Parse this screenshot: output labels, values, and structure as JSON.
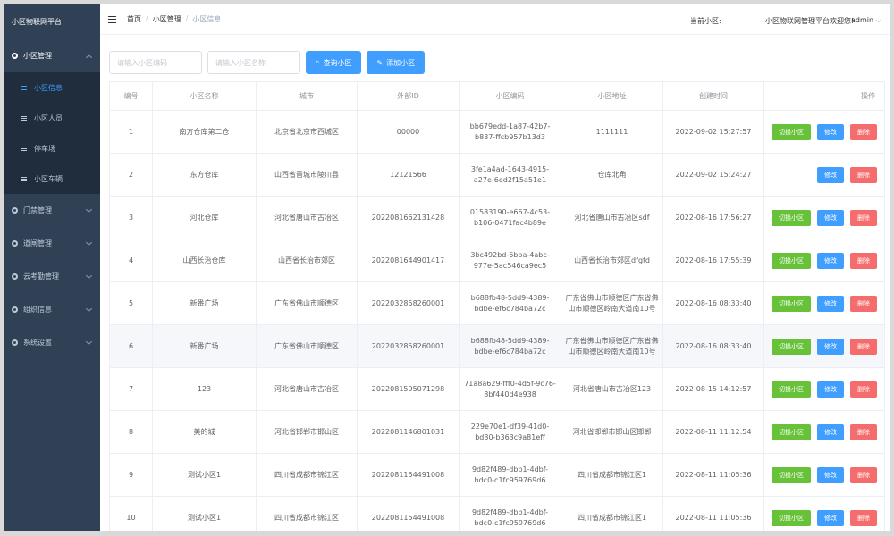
{
  "app": {
    "title": "小区物联网平台"
  },
  "sidebar": {
    "menus": [
      {
        "label": "小区管理",
        "open": true,
        "items": [
          {
            "label": "小区信息",
            "active": true
          },
          {
            "label": "小区人员",
            "active": false
          },
          {
            "label": "停车场",
            "active": false
          },
          {
            "label": "小区车辆",
            "active": false
          }
        ]
      },
      {
        "label": "门禁管理",
        "open": false,
        "items": []
      },
      {
        "label": "道闸管理",
        "open": false,
        "items": []
      },
      {
        "label": "云考勤管理",
        "open": false,
        "items": []
      },
      {
        "label": "组织信息",
        "open": false,
        "items": []
      },
      {
        "label": "系统设置",
        "open": false,
        "items": []
      }
    ]
  },
  "header": {
    "breadcrumb": [
      "首页",
      "小区管理",
      "小区信息"
    ],
    "current_label": "当前小区:",
    "welcome": "小区物联网管理平台欢迎您!",
    "user": "admin"
  },
  "toolbar": {
    "code_placeholder": "请输入小区编码",
    "name_placeholder": "请输入小区名称",
    "query_label": "查询小区",
    "add_label": "添加小区"
  },
  "table": {
    "columns": [
      "编号",
      "小区名称",
      "城市",
      "外部ID",
      "小区编码",
      "小区地址",
      "创建时间",
      "操作"
    ],
    "op_labels": {
      "switch": "切换小区",
      "edit": "修改",
      "delete": "删除"
    },
    "rows": [
      {
        "no": "1",
        "name": "南方仓库第二仓",
        "city": "北京省北京市西城区",
        "ext": "00000",
        "code": "bb679edd-1a87-42b7-b837-ffcb957b13d3",
        "addr": "1111111",
        "time": "2022-09-02 15:27:57",
        "switch": true
      },
      {
        "no": "2",
        "name": "东方仓库",
        "city": "山西省晋城市陵川县",
        "ext": "12121566",
        "code": "3fe1a4ad-1643-4915-a27e-6ed2f15a51e1",
        "addr": "仓库北角",
        "time": "2022-09-02 15:24:27",
        "switch": false
      },
      {
        "no": "3",
        "name": "河北仓库",
        "city": "河北省唐山市古冶区",
        "ext": "2022081662131428",
        "code": "01583190-e667-4c53-b106-0471fac4b89e",
        "addr": "河北省唐山市古冶区sdf",
        "time": "2022-08-16 17:56:27",
        "switch": true
      },
      {
        "no": "4",
        "name": "山西长治仓库",
        "city": "山西省长治市郊区",
        "ext": "2022081644901417",
        "code": "3bc492bd-6bba-4abc-977e-5ac546ca9ec5",
        "addr": "山西省长治市郊区dfgfd",
        "time": "2022-08-16 17:55:39",
        "switch": true
      },
      {
        "no": "5",
        "name": "新番广场",
        "city": "广东省佛山市顺德区",
        "ext": "2022032858260001",
        "code": "b688fb48-5dd9-4389-bdbe-ef6c784ba72c",
        "addr": "广东省佛山市顺德区广东省佛山市顺德区岭南大道南10号",
        "time": "2022-08-16 08:33:40",
        "switch": true
      },
      {
        "no": "6",
        "name": "新番广场",
        "city": "广东省佛山市顺德区",
        "ext": "2022032858260001",
        "code": "b688fb48-5dd9-4389-bdbe-ef6c784ba72c",
        "addr": "广东省佛山市顺德区广东省佛山市顺德区岭南大道南10号",
        "time": "2022-08-16 08:33:40",
        "switch": true
      },
      {
        "no": "7",
        "name": "123",
        "city": "河北省唐山市古冶区",
        "ext": "2022081595071298",
        "code": "71a8a629-fff0-4d5f-9c76-8bf440d4e938",
        "addr": "河北省唐山市古冶区123",
        "time": "2022-08-15 14:12:57",
        "switch": true
      },
      {
        "no": "8",
        "name": "美的城",
        "city": "河北省邯郸市邯山区",
        "ext": "2022081146801031",
        "code": "229e70e1-df39-41d0-bd30-b363c9a81eff",
        "addr": "河北省邯郸市邯山区邯郸",
        "time": "2022-08-11 11:12:54",
        "switch": true
      },
      {
        "no": "9",
        "name": "测试小区1",
        "city": "四川省成都市锦江区",
        "ext": "2022081154491008",
        "code": "9d82f489-dbb1-4dbf-bdc0-c1fc959769d6",
        "addr": "四川省成都市锦江区1",
        "time": "2022-08-11 11:05:36",
        "switch": true
      },
      {
        "no": "10",
        "name": "测试小区1",
        "city": "四川省成都市锦江区",
        "ext": "2022081154491008",
        "code": "9d82f489-dbb1-4dbf-bdc0-c1fc959769d6",
        "addr": "四川省成都市锦江区1",
        "time": "2022-08-11 11:05:36",
        "switch": true
      }
    ]
  }
}
